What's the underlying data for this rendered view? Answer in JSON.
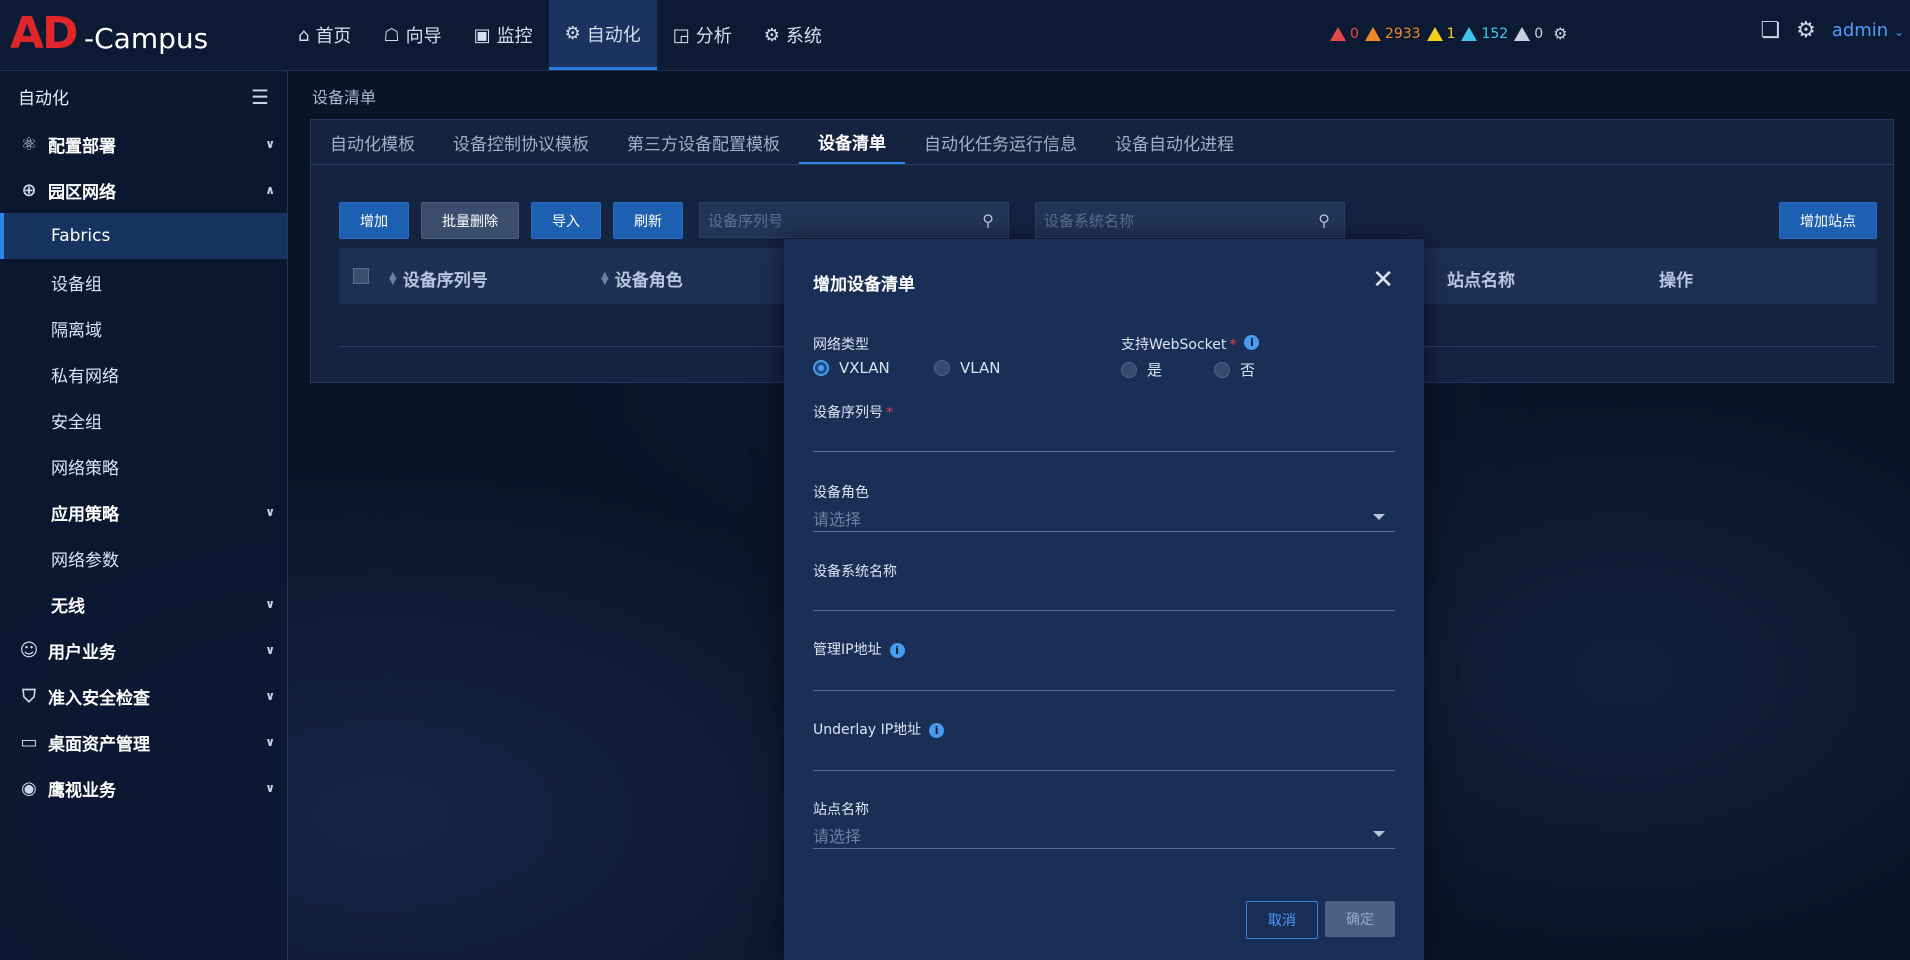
{
  "app": {
    "logo_ad": "AD",
    "logo_campus": "-Campus"
  },
  "nav": {
    "items": [
      {
        "label": "首页",
        "icon": "home-icon"
      },
      {
        "label": "向导",
        "icon": "guide-icon"
      },
      {
        "label": "监控",
        "icon": "monitor-icon"
      },
      {
        "label": "自动化",
        "icon": "automation-icon",
        "active": true
      },
      {
        "label": "分析",
        "icon": "analysis-icon"
      },
      {
        "label": "系统",
        "icon": "system-icon"
      }
    ]
  },
  "alarms": [
    {
      "count": "0",
      "color": "#e8474a"
    },
    {
      "count": "2933",
      "color": "#f08a24"
    },
    {
      "count": "1",
      "color": "#f2d21c"
    },
    {
      "count": "152",
      "color": "#43c4f0"
    },
    {
      "count": "0",
      "color": "#c9d1de"
    }
  ],
  "user": {
    "name": "admin"
  },
  "sidebar": {
    "title": "自动化",
    "items": [
      {
        "label": "配置部署",
        "type": "group",
        "expanded": false
      },
      {
        "label": "园区网络",
        "type": "group",
        "expanded": true
      },
      {
        "label": "Fabrics",
        "type": "sub",
        "active": true
      },
      {
        "label": "设备组",
        "type": "sub"
      },
      {
        "label": "隔离域",
        "type": "sub"
      },
      {
        "label": "私有网络",
        "type": "sub"
      },
      {
        "label": "安全组",
        "type": "sub"
      },
      {
        "label": "网络策略",
        "type": "sub"
      },
      {
        "label": "应用策略",
        "type": "subgroup"
      },
      {
        "label": "网络参数",
        "type": "sub"
      },
      {
        "label": "无线",
        "type": "subgroup"
      },
      {
        "label": "用户业务",
        "type": "group"
      },
      {
        "label": "准入安全检查",
        "type": "group"
      },
      {
        "label": "桌面资产管理",
        "type": "group"
      },
      {
        "label": "鹰视业务",
        "type": "group"
      }
    ]
  },
  "breadcrumb": "设备清单",
  "tabs": [
    "自动化模板",
    "设备控制协议模板",
    "第三方设备配置模板",
    "设备清单",
    "自动化任务运行信息",
    "设备自动化进程"
  ],
  "active_tab": "设备清单",
  "toolbar": {
    "add": "增加",
    "batch_delete": "批量删除",
    "import": "导入",
    "refresh": "刷新",
    "search_serial_placeholder": "设备序列号",
    "search_sysname_placeholder": "设备系统名称",
    "add_site": "增加站点"
  },
  "table": {
    "columns": [
      "设备序列号",
      "设备角色",
      "站点名称",
      "操作"
    ]
  },
  "modal": {
    "title": "增加设备清单",
    "network_type_label": "网络类型",
    "network_type_options": [
      "VXLAN",
      "VLAN"
    ],
    "network_type_selected": "VXLAN",
    "websocket_label": "支持WebSocket",
    "websocket_options": [
      "是",
      "否"
    ],
    "serial_label": "设备序列号",
    "role_label": "设备角色",
    "role_placeholder": "请选择",
    "sysname_label": "设备系统名称",
    "mgmt_ip_label": "管理IP地址",
    "underlay_ip_label": "Underlay IP地址",
    "site_label": "站点名称",
    "site_placeholder": "请选择",
    "cancel": "取消",
    "ok": "确定",
    "required_mark": "*",
    "info_mark": "i"
  }
}
